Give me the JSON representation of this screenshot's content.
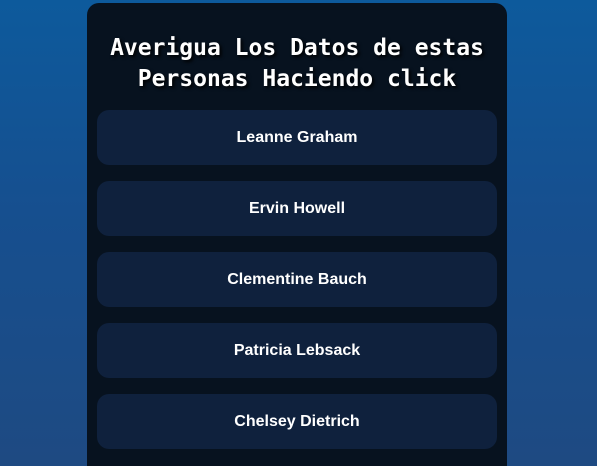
{
  "header": {
    "title_line1": "Averigua Los Datos de estas",
    "title_line2": "Personas Haciendo click"
  },
  "people": [
    {
      "name": "Leanne Graham"
    },
    {
      "name": "Ervin Howell"
    },
    {
      "name": "Clementine Bauch"
    },
    {
      "name": "Patricia Lebsack"
    },
    {
      "name": "Chelsey Dietrich"
    }
  ],
  "colors": {
    "background_top": "#0d5a9c",
    "background_bottom": "#1e4a82",
    "panel": "#07121f",
    "button": "#0f213d",
    "text": "#ffffff"
  }
}
